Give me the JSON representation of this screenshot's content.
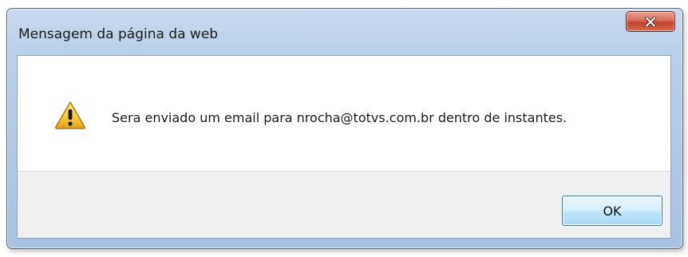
{
  "dialog": {
    "title": "Mensagem da página da web",
    "message": "Sera enviado um email para nrocha@totvs.com.br dentro de instantes.",
    "ok_label": "OK",
    "icon": "warning-icon",
    "close_icon": "close-icon"
  },
  "colors": {
    "close_button": "#c2432b",
    "warning_fill": "#f6c73a",
    "ok_border": "#3c7fb1"
  }
}
